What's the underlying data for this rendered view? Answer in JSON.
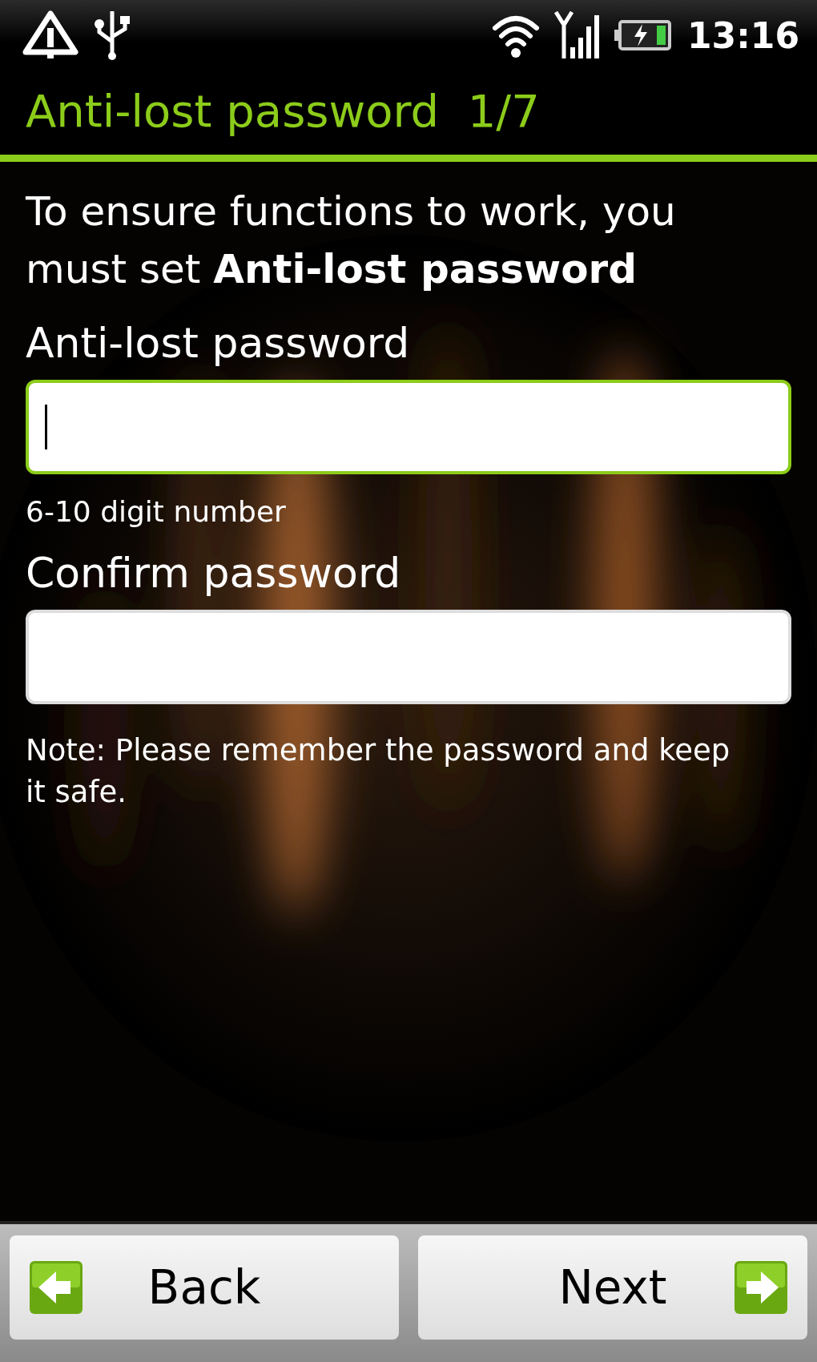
{
  "status_bar": {
    "time": "13:16"
  },
  "title": "Anti-lost password  1/7",
  "intro": "To ensure functions to work, you must set **Anti-lost password**",
  "fields": [
    {
      "label": "Anti-lost password",
      "focused": true,
      "hint": "6-10 digit number"
    },
    {
      "label": "Confirm password",
      "focused": false
    }
  ],
  "note": "Note: Please remember the password and keep it safe.",
  "buttons": [
    {
      "label": "Back",
      "kind": "back"
    },
    {
      "label": "Next",
      "kind": "next"
    }
  ]
}
